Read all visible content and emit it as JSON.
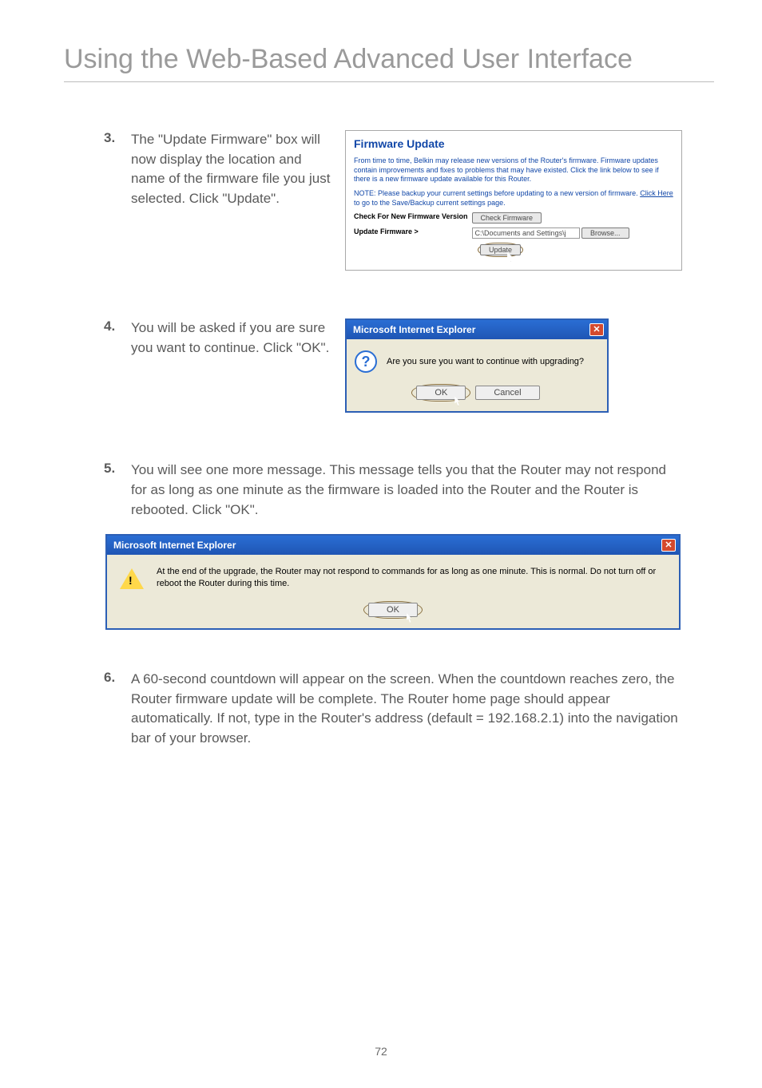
{
  "title": "Using the Web-Based Advanced User Interface",
  "step3": {
    "num": "3.",
    "text": "The \"Update Firmware\" box will now display the location and name of the firmware file you just selected. Click \"Update\"."
  },
  "step4": {
    "num": "4.",
    "text": "You will be asked if you are sure you want to continue. Click \"OK\"."
  },
  "step5": {
    "num": "5.",
    "text": "You will see one more message. This message tells you that the Router may not respond for as long as one minute as the firmware is loaded into the Router and the Router is rebooted. Click \"OK\"."
  },
  "step6": {
    "num": "6.",
    "text": "A 60-second countdown will appear on the screen. When the countdown reaches zero, the Router firmware update will be complete. The Router home page should appear automatically. If not, type in the Router's address (default = 192.168.2.1) into the navigation bar of your browser."
  },
  "firmware": {
    "title": "Firmware Update",
    "intro": "From time to time, Belkin may release new versions of the Router's firmware. Firmware updates contain improvements and fixes to problems that may have existed. Click the link below to see if there is a new firmware update available for this Router.",
    "note_prefix": "NOTE: Please backup your current settings before updating to a new version of firmware.",
    "note_link": "Click Here",
    "note_suffix": " to go to the Save/Backup current settings page.",
    "check_label": "Check For New Firmware Version",
    "check_btn": "Check Firmware",
    "update_label": "Update Firmware >",
    "update_value": "C:\\Documents and Settings\\j",
    "browse_btn": "Browse...",
    "update_btn": "Update"
  },
  "dialog1": {
    "title": "Microsoft Internet Explorer",
    "msg": "Are you sure you want to continue with upgrading?",
    "ok": "OK",
    "cancel": "Cancel"
  },
  "dialog2": {
    "title": "Microsoft Internet Explorer",
    "msg": "At the end of the upgrade, the Router may not respond to commands for as long as one minute. This is normal. Do not turn off or reboot the Router during this time.",
    "ok": "OK"
  },
  "pageNumber": "72"
}
